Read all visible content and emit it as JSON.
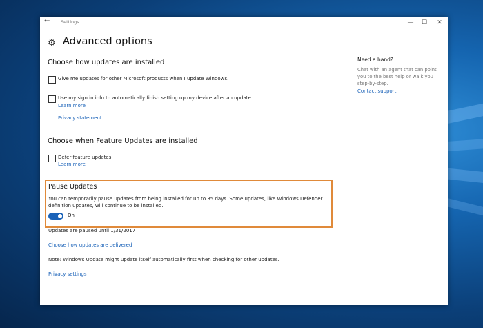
{
  "titlebar": {
    "title": "Settings",
    "back_glyph": "←",
    "min_glyph": "—",
    "max_glyph": "☐",
    "close_glyph": "✕"
  },
  "page": {
    "title": "Advanced options",
    "icon": "gear-icon"
  },
  "section_install": {
    "title": "Choose how updates are installed",
    "option1": "Give me updates for other Microsoft products when I update Windows.",
    "option2": "Use my sign in info to automatically finish setting up my device after an update.",
    "learn_more": "Learn more",
    "privacy": "Privacy statement"
  },
  "section_feature": {
    "title": "Choose when Feature Updates are installed",
    "defer": "Defer feature updates",
    "learn_more": "Learn more"
  },
  "pause": {
    "title": "Pause Updates",
    "description": "You can temporarily pause updates from being installed for up to 35 days. Some updates, like Windows Defender definition updates, will continue to be installed.",
    "toggle_label": "On",
    "toggle_on": true,
    "paused_until": "Updates are paused until 1/31/2017"
  },
  "links": {
    "delivery": "Choose how updates are delivered",
    "note": "Note: Windows Update might update itself automatically first when checking for other updates.",
    "privacy_settings": "Privacy settings"
  },
  "sidebar": {
    "title": "Need a hand?",
    "text": "Chat with an agent that can point you to the best help or walk you step-by-step.",
    "link": "Contact support"
  },
  "colors": {
    "accent": "#1a62b8",
    "highlight_border": "#e08a3a"
  }
}
